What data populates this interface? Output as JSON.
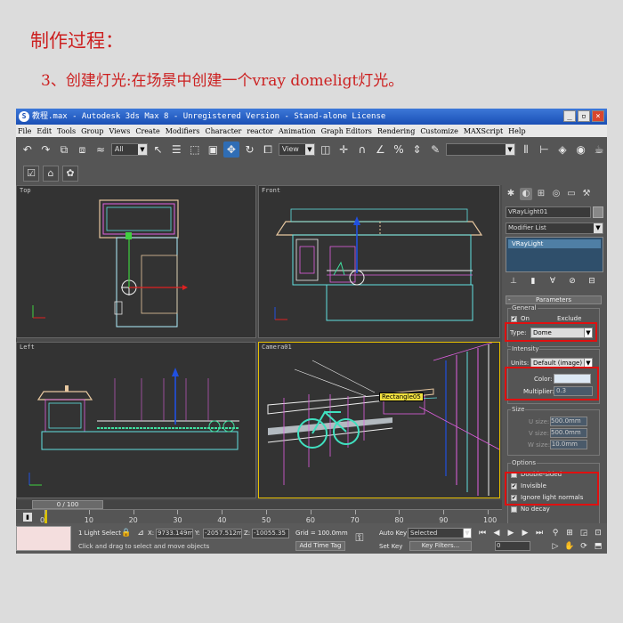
{
  "heading": {
    "line1": "制作过程：",
    "line2": "3、创建灯光:在场景中创建一个vray domeligt灯光。"
  },
  "window": {
    "title": "教程.max - Autodesk 3ds Max 8  - Unregistered Version - Stand-alone License",
    "buttons": {
      "minimize": "_",
      "restore": "▫",
      "close": "×"
    }
  },
  "menu": [
    "File",
    "Edit",
    "Tools",
    "Group",
    "Views",
    "Create",
    "Modifiers",
    "Character",
    "reactor",
    "Animation",
    "Graph Editors",
    "Rendering",
    "Customize",
    "MAXScript",
    "Help"
  ],
  "toolbar": {
    "selection_filter": "All",
    "reference_coord": "View"
  },
  "viewports": {
    "top": "Top",
    "front": "Front",
    "left": "Left",
    "camera": "Camera01",
    "camera_tag": "Rectangle05"
  },
  "command_panel": {
    "object_name": "VRayLight01",
    "modifier_list": "Modifier List",
    "stack_item": "VRayLight",
    "parameters_rollout": "Parameters",
    "general_label": "General",
    "on_label": "On",
    "exclude_label": "Exclude",
    "type_label": "Type:",
    "type_value": "Dome",
    "intensity_label": "Intensity",
    "units_label": "Units:",
    "units_value": "Default (image)",
    "color_label": "Color:",
    "light_color": "#dce8f4",
    "multiplier_label": "Multiplier:",
    "multiplier_value": "0.3",
    "size_label": "Size",
    "u_size_label": "U size:",
    "u_size_value": "500.0mm",
    "v_size_label": "V size:",
    "v_size_value": "500.0mm",
    "w_size_label": "W size:",
    "w_size_value": "10.0mm",
    "options_label": "Options",
    "double_sided": "Double-sided",
    "invisible": "Invisible",
    "ignore_normals": "Ignore light normals",
    "no_decay": "No decay"
  },
  "timeline": {
    "slider": "0 / 100",
    "ticks": [
      "0",
      "10",
      "20",
      "30",
      "40",
      "50",
      "60",
      "70",
      "80",
      "90",
      "100"
    ]
  },
  "status": {
    "selection": "1 Light Select",
    "x_label": "X:",
    "x_value": "9733.149m",
    "y_label": "Y:",
    "y_value": "-2057.512m",
    "z_label": "Z:",
    "z_value": "-10055.35",
    "grid": "Grid = 100.0mm",
    "prompt": "Click and drag to select and move objects",
    "add_time_tag": "Add Time Tag",
    "auto_key": "Auto Key",
    "set_key": "Set Key",
    "key_mode": "Selected",
    "key_filters": "Key Filters...",
    "frame": "0"
  },
  "colors": {
    "highlight": "#e01010",
    "heading": "#cc2020"
  }
}
